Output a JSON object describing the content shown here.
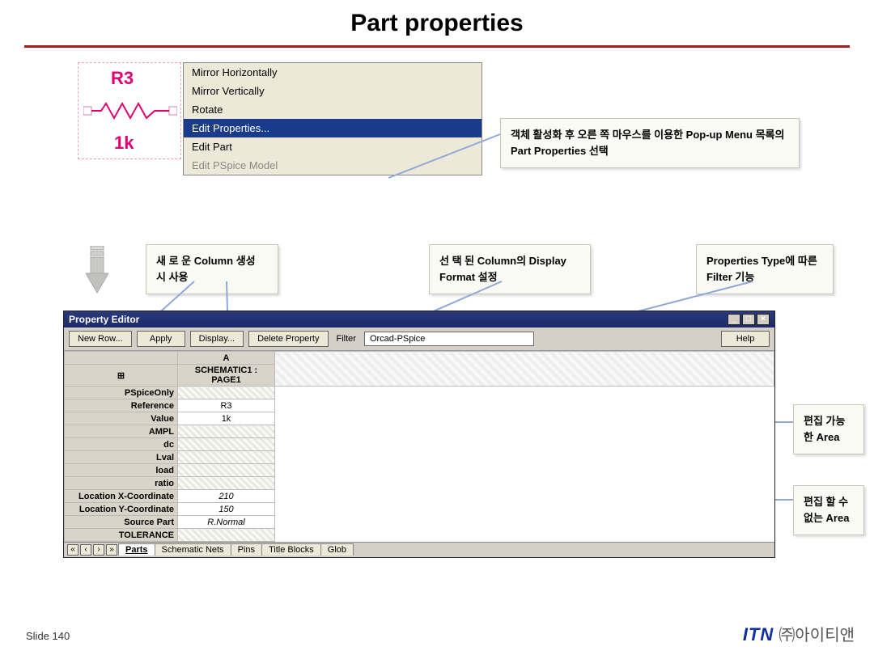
{
  "title": "Part properties",
  "resistor": {
    "ref": "R3",
    "value": "1k"
  },
  "context_menu": {
    "items": [
      {
        "label": "Mirror Horizontally",
        "state": "normal"
      },
      {
        "label": "Mirror Vertically",
        "state": "normal"
      },
      {
        "label": "Rotate",
        "state": "normal"
      },
      {
        "label": "Edit Properties...",
        "state": "selected"
      },
      {
        "label": "Edit Part",
        "state": "normal"
      },
      {
        "label": "Edit PSpice Model",
        "state": "disabled"
      }
    ]
  },
  "callouts": {
    "popup": "객체 활성화 후 오른 쪽 마우스를 이용한 Pop-up Menu 목록의 Part Properties 선택",
    "new_col": "새 로 운  Column 생성 시 사용",
    "sel_col": "선 택 된    Column의 Display Format 설정",
    "filter": "Properties  Type에 따른 Filter 기능",
    "editable": "편집 가능한 Area",
    "readonly": "편집 할 수 없는 Area"
  },
  "editor": {
    "window_title": "Property Editor",
    "toolbar": {
      "new_row": "New Row...",
      "apply": "Apply",
      "display": "Display...",
      "delete": "Delete Property",
      "filter_label": "Filter",
      "filter_value": "Orcad-PSpice",
      "help": "Help"
    },
    "grid": {
      "col_header": "A",
      "page": "SCHEMATIC1 : PAGE1",
      "rows": [
        {
          "name": "PSpiceOnly",
          "val": "",
          "hatched": true
        },
        {
          "name": "Reference",
          "val": "R3",
          "hatched": true
        },
        {
          "name": "Value",
          "val": "1k",
          "hatched": true
        },
        {
          "name": "AMPL",
          "val": "",
          "hatched": true
        },
        {
          "name": "dc",
          "val": "",
          "hatched": true
        },
        {
          "name": "Lval",
          "val": "",
          "hatched": true
        },
        {
          "name": "load",
          "val": "",
          "hatched": true
        },
        {
          "name": "ratio",
          "val": "",
          "hatched": true
        },
        {
          "name": "Location X-Coordinate",
          "val": "210",
          "hatched": false
        },
        {
          "name": "Location Y-Coordinate",
          "val": "150",
          "hatched": false
        },
        {
          "name": "Source Part",
          "val": "R.Normal",
          "hatched": false
        },
        {
          "name": "TOLERANCE",
          "val": "",
          "hatched": true
        }
      ]
    },
    "tabs": [
      "Parts",
      "Schematic Nets",
      "Pins",
      "Title Blocks",
      "Glob"
    ],
    "active_tab": 0
  },
  "footer": {
    "slide": "Slide 140",
    "brand1": "ITN",
    "brand2": "㈜아이티앤"
  }
}
